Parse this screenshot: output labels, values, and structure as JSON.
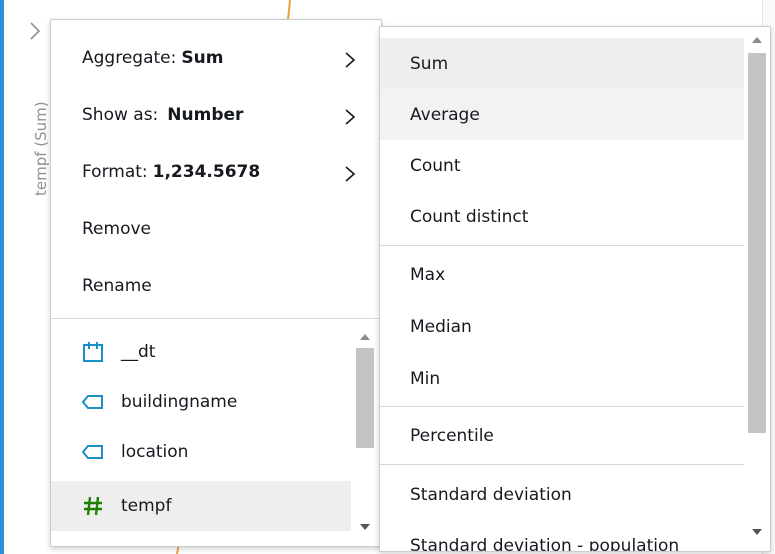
{
  "axis": {
    "label": "tempf (Sum)"
  },
  "menu": {
    "aggregate_label": "Aggregate:",
    "aggregate_value": "Sum",
    "show_as_label": "Show as:",
    "show_as_value": "Number",
    "format_label": "Format:",
    "format_value": "1,234.5678",
    "remove": "Remove",
    "rename": "Rename"
  },
  "fields": [
    {
      "name": "__dt",
      "icon": "calendar-icon"
    },
    {
      "name": "buildingname",
      "icon": "dimension-tag-icon"
    },
    {
      "name": "location",
      "icon": "dimension-tag-icon"
    },
    {
      "name": "tempf",
      "icon": "measure-hash-icon",
      "selected": true
    }
  ],
  "aggregate_options": [
    "Sum",
    "Average",
    "Count",
    "Count distinct",
    "Max",
    "Median",
    "Min",
    "Percentile",
    "Standard deviation",
    "Standard deviation - population"
  ],
  "colors": {
    "accent": "#2d8fd5",
    "dimension_icon": "#1a8fc9",
    "measure_icon": "#1d8102",
    "orange_line": "#e8a43c"
  }
}
